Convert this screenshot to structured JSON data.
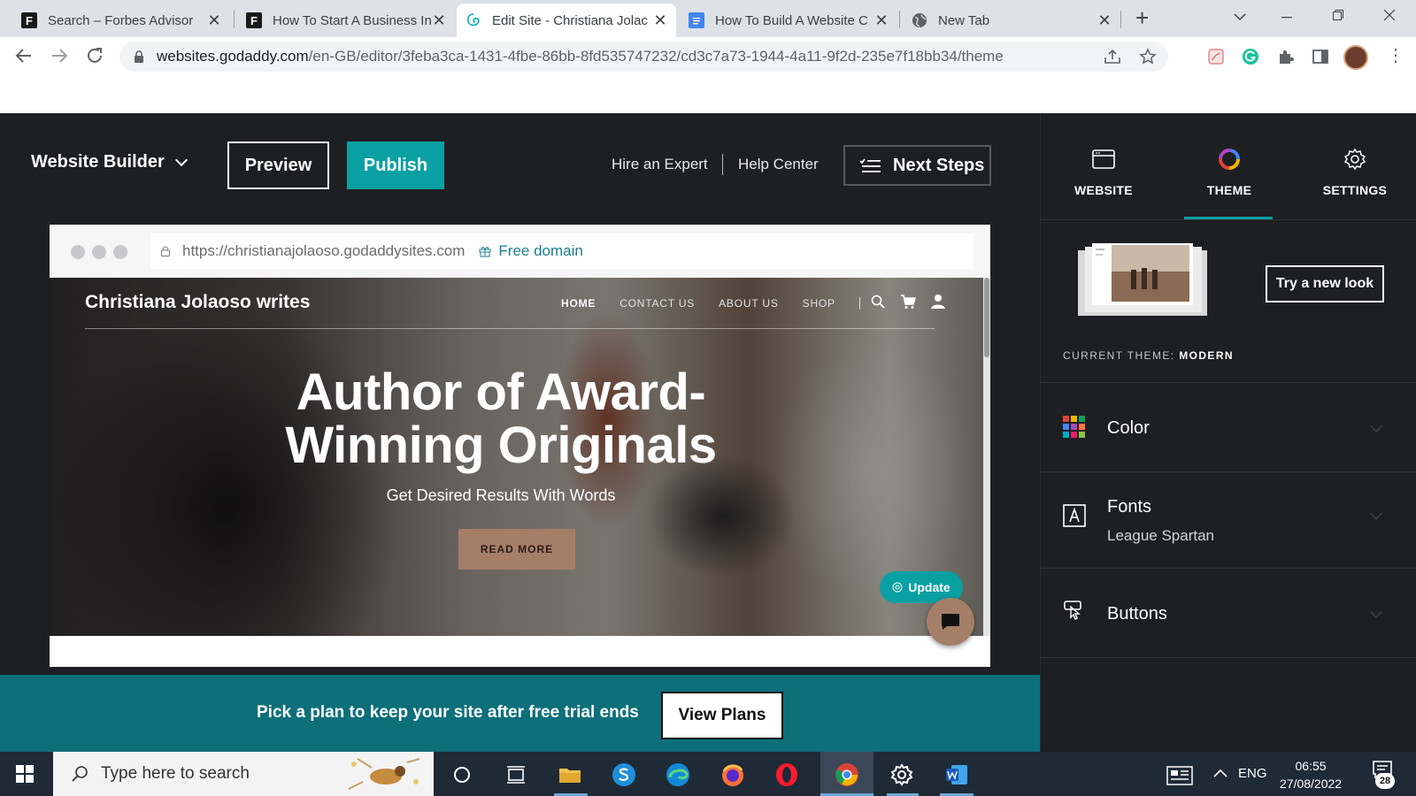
{
  "browser": {
    "tabs": [
      {
        "title": "Search – Forbes Advisor",
        "favicon": "forbes-f-icon",
        "active": false
      },
      {
        "title": "How To Start A Business In",
        "favicon": "forbes-f-icon",
        "active": false
      },
      {
        "title": "Edit Site - Christiana Jolac",
        "favicon": "godaddy-icon",
        "active": true
      },
      {
        "title": "How To Build A Website C",
        "favicon": "google-docs-icon",
        "active": false
      },
      {
        "title": "New Tab",
        "favicon": "globe-icon",
        "active": false
      }
    ],
    "url_host": "websites.godaddy.com",
    "url_path": "/en-GB/editor/3feba3ca-1431-4fbe-86bb-8fd535747232/cd3c7a73-1944-4a11-9f2d-235e7f18bb34/theme"
  },
  "editor": {
    "brand_menu": "Website Builder",
    "preview_label": "Preview",
    "publish_label": "Publish",
    "hire_label": "Hire an Expert",
    "help_label": "Help Center",
    "next_steps_label": "Next Steps"
  },
  "preview": {
    "url": "https://christianajolaoso.godaddysites.com",
    "free_domain": "Free domain",
    "site_title": "Christiana Jolaoso writes",
    "nav": [
      "HOME",
      "CONTACT US",
      "ABOUT US",
      "SHOP"
    ],
    "heading": "Author of Award-Winning Originals",
    "subheading": "Get Desired Results With Words",
    "cta": "READ MORE",
    "update_label": "Update"
  },
  "banner": {
    "text": "Pick a plan to keep your site after free trial ends",
    "button": "View Plans"
  },
  "panel": {
    "tabs": [
      {
        "label": "WEBSITE",
        "icon": "browser-window-icon"
      },
      {
        "label": "THEME",
        "icon": "color-ring-icon",
        "active": true
      },
      {
        "label": "SETTINGS",
        "icon": "gear-icon"
      }
    ],
    "try_new_look": "Try a new look",
    "current_theme_label": "CURRENT THEME:",
    "current_theme_value": "MODERN",
    "rows": {
      "color": {
        "label": "Color"
      },
      "fonts": {
        "label": "Fonts",
        "value": "League Spartan"
      },
      "buttons": {
        "label": "Buttons"
      }
    },
    "accent_color": "#09a0a3"
  },
  "taskbar": {
    "search_placeholder": "Type here to search",
    "language": "ENG",
    "time": "06:55",
    "date": "27/08/2022",
    "notifications": "28"
  }
}
